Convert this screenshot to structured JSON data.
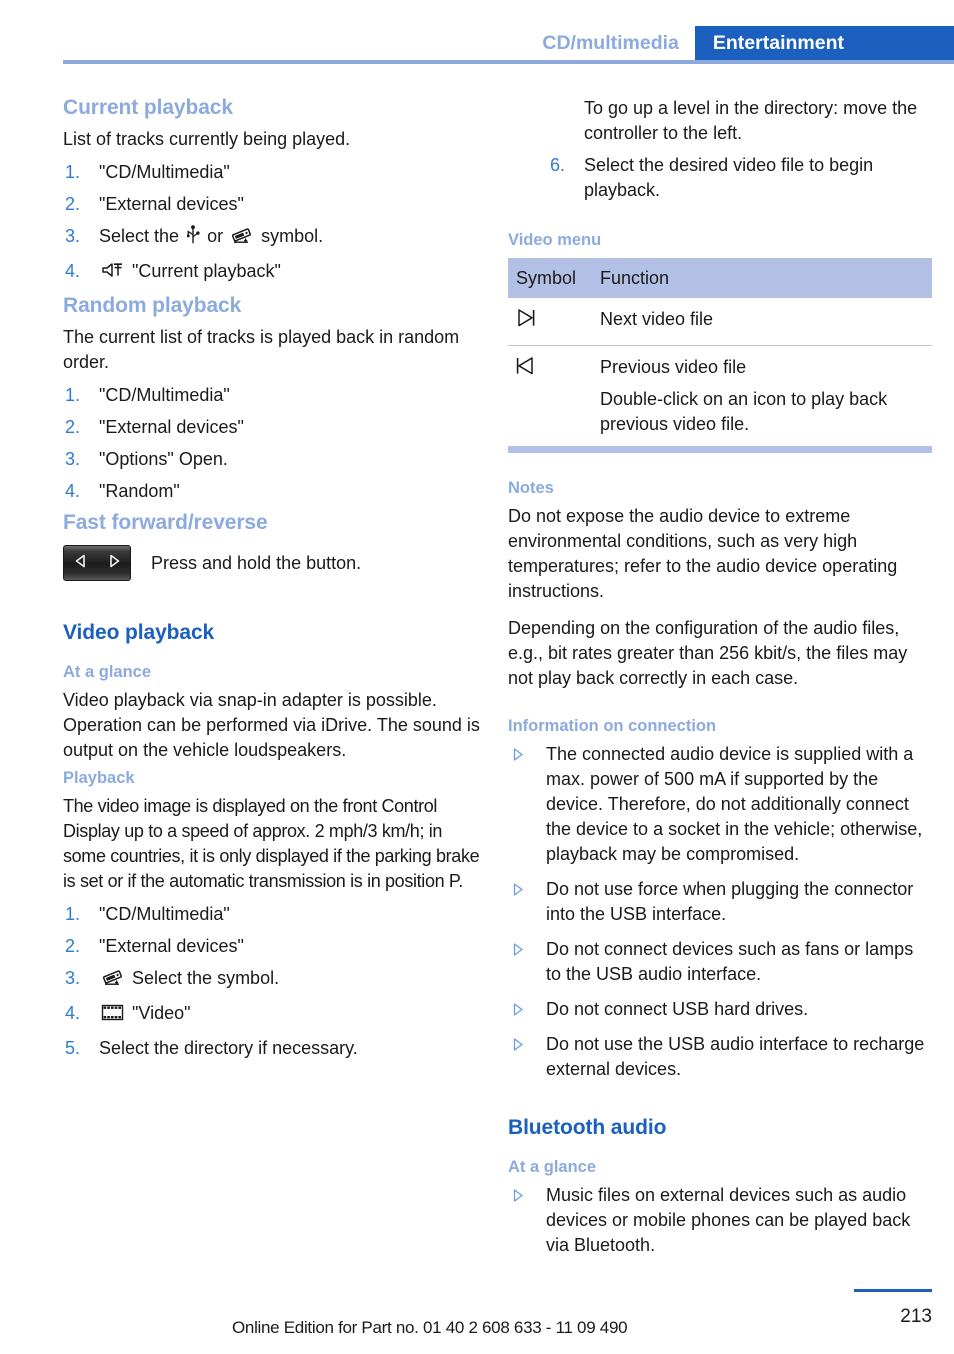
{
  "header": {
    "breadcrumb_section": "CD/multimedia",
    "breadcrumb_chapter": "Entertainment",
    "accent_blue": "#1b5fbf",
    "accent_light_blue": "#8caade"
  },
  "left_column": {
    "current_playback": {
      "heading": "Current playback",
      "intro": "List of tracks currently being played.",
      "steps": [
        {
          "text": "\"CD/Multimedia\""
        },
        {
          "text": "\"External devices\""
        },
        {
          "pre": "Select the",
          "icon1": "usb-icon",
          "mid": "or",
          "icon2": "snap-in-adapter-icon",
          "post": "symbol."
        },
        {
          "icon": "speaker-output-icon",
          "text": "\"Current playback\""
        }
      ]
    },
    "random_playback": {
      "heading": "Random playback",
      "intro": "The current list of tracks is played back in random order.",
      "steps": [
        "\"CD/Multimedia\"",
        "\"External devices\"",
        "\"Options\" Open.",
        "\"Random\""
      ]
    },
    "fast_forward_reverse": {
      "heading": "Fast forward/reverse",
      "button_left_glyph": "rewind-triangle-icon",
      "button_right_glyph": "forward-triangle-icon",
      "caption": "Press and hold the button."
    },
    "video_playback": {
      "heading": "Video playback",
      "at_a_glance": {
        "heading": "At a glance",
        "text": "Video playback via snap-in adapter is possible. Operation can be performed via iDrive. The sound is output on the vehicle loudspeakers."
      },
      "playback": {
        "heading": "Playback",
        "text": "The video image is displayed on the front Control Display up to a speed of approx. 2 mph/3 km/h; in some countries, it is only displayed if the parking brake is set or if the automatic transmission is in position P.",
        "steps": [
          {
            "text": "\"CD/Multimedia\""
          },
          {
            "text": "\"External devices\""
          },
          {
            "icon": "snap-in-adapter-icon",
            "text": "Select the symbol."
          },
          {
            "icon": "film-strip-icon",
            "text": "\"Video\""
          },
          {
            "text": "Select the directory if necessary."
          }
        ]
      }
    }
  },
  "right_column": {
    "continued_steps": {
      "continuation_text": "To go up a level in the directory: move the controller to the left.",
      "step6_number": "6.",
      "step6_text": "Select the desired video file to begin playback."
    },
    "video_menu": {
      "heading": "Video menu",
      "columns": [
        "Symbol",
        "Function"
      ],
      "rows": [
        {
          "symbol": "next-track-icon",
          "function": "Next video file",
          "sub": ""
        },
        {
          "symbol": "previous-track-icon",
          "function": "Previous video file",
          "sub": "Double-click on an icon to play back previous video file."
        }
      ],
      "header_bg": "#b3c0e6"
    },
    "notes": {
      "heading": "Notes",
      "paragraphs": [
        "Do not expose the audio device to extreme environmental conditions, such as very high temperatures; refer to the audio device operating instructions.",
        "Depending on the configuration of the audio files, e.g., bit rates greater than 256 kbit/s, the files may not play back correctly in each case."
      ]
    },
    "information_on_connection": {
      "heading": "Information on connection",
      "bullets": [
        "The connected audio device is supplied with a max. power of 500 mA if supported by the device. Therefore, do not additionally connect the device to a socket in the vehicle; otherwise, playback may be compromised.",
        "Do not use force when plugging the connector into the USB interface.",
        "Do not connect devices such as fans or lamps to the USB audio interface.",
        "Do not connect USB hard drives.",
        "Do not use the USB audio interface to recharge external devices."
      ]
    },
    "bluetooth_audio": {
      "heading": "Bluetooth audio",
      "at_a_glance": {
        "heading": "At a glance",
        "bullets": [
          "Music files on external devices such as audio devices or mobile phones can be played back via Bluetooth."
        ]
      }
    }
  },
  "footer": {
    "edition_note": "Online Edition for Part no. 01 40 2 608 633 - 11 09 490",
    "page_number": "213"
  }
}
